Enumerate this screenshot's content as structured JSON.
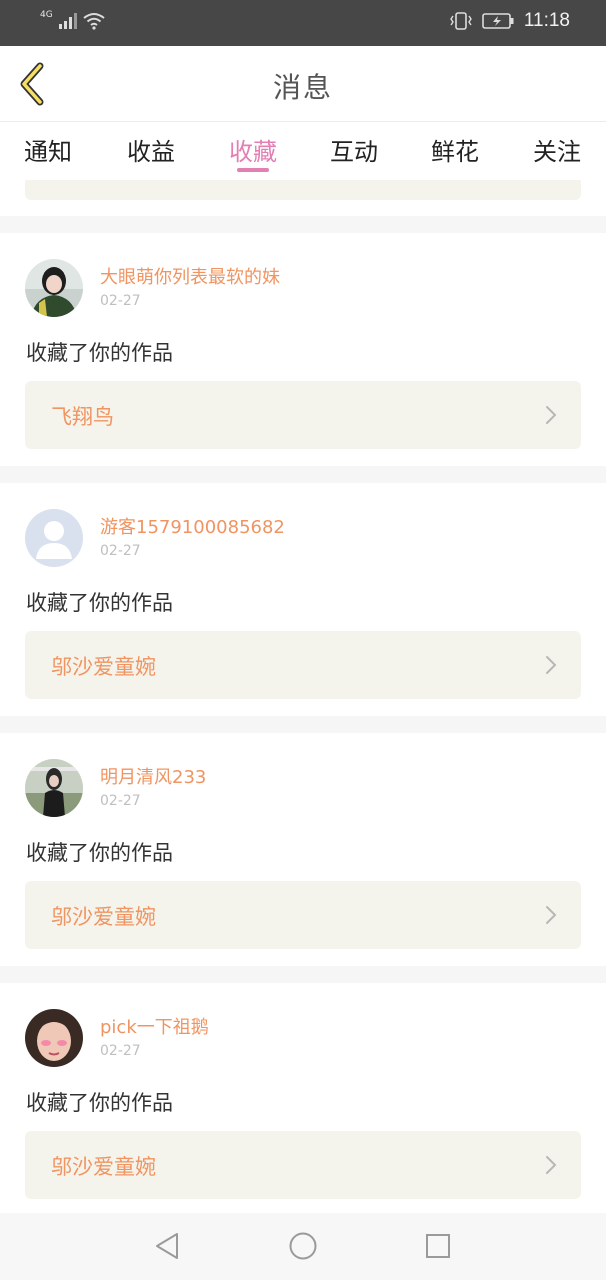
{
  "status_bar": {
    "network": "4G",
    "time": "11:18",
    "icons": [
      "signal-icon",
      "wifi-icon",
      "vibrate-icon",
      "battery-charging-icon"
    ]
  },
  "header": {
    "title": "消息",
    "back_icon": "chevron-left-icon"
  },
  "tabs": [
    {
      "label": "通知",
      "active": false
    },
    {
      "label": "收益",
      "active": false
    },
    {
      "label": "收藏",
      "active": true
    },
    {
      "label": "互动",
      "active": false
    },
    {
      "label": "鲜花",
      "active": false
    },
    {
      "label": "关注",
      "active": false
    }
  ],
  "notifications": [
    {
      "username": "大眼萌你列表最软的妹",
      "date": "02-27",
      "action": "收藏了你的作品",
      "work_title": "飞翔鸟"
    },
    {
      "username": "游客1579100085682",
      "date": "02-27",
      "action": "收藏了你的作品",
      "work_title": "邬沙爱童婉"
    },
    {
      "username": "明月清风233",
      "date": "02-27",
      "action": "收藏了你的作品",
      "work_title": "邬沙爱童婉"
    },
    {
      "username": "pick一下祖鹅",
      "date": "02-27",
      "action": "收藏了你的作品",
      "work_title": "邬沙爱童婉"
    }
  ],
  "navbar": {
    "icons": [
      "back-triangle-icon",
      "home-circle-icon",
      "recents-square-icon"
    ]
  },
  "colors": {
    "accent_pink": "#e27fb4",
    "name_orange": "#f09461",
    "card_bg": "#f5f4ec"
  }
}
